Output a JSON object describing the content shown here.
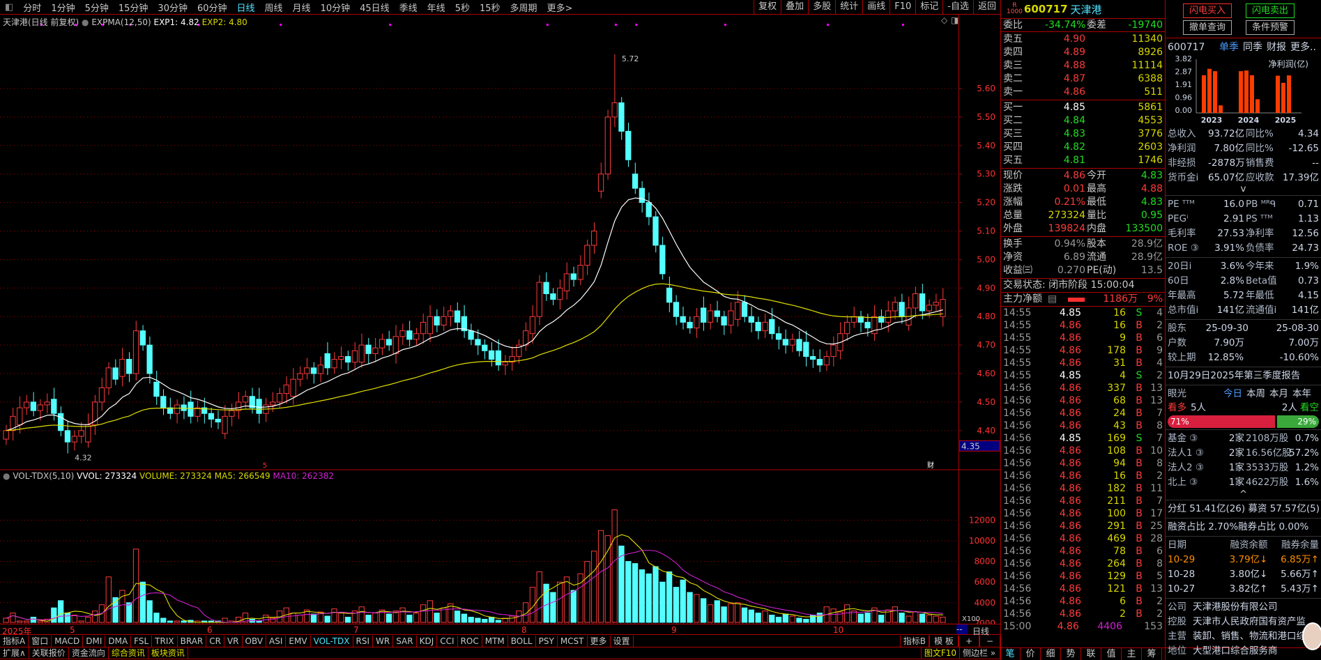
{
  "toolbar": {
    "periods": [
      "分时",
      "1分钟",
      "5分钟",
      "15分钟",
      "30分钟",
      "60分钟",
      "日线",
      "周线",
      "月线",
      "10分钟",
      "45日线",
      "季线",
      "年线",
      "5秒",
      "15秒",
      "多周期",
      "更多>"
    ],
    "active": "日线",
    "right": [
      "复权",
      "叠加",
      "多股",
      "统计",
      "画线",
      "F10",
      "标记",
      "-自选",
      "返回"
    ]
  },
  "chart_header": {
    "title": "天津港(日线 前复权)",
    "indicator": "EXPMA(12,50)",
    "exp1": "EXP1: 4.82",
    "exp2": "EXP2: 4.80"
  },
  "vol_header": {
    "name": "VOL-TDX(5,10)",
    "vvol": "VVOL: 273324",
    "volume": "VOLUME: 273324",
    "ma5": "MA5: 266549",
    "ma10": "MA10: 262382"
  },
  "colors": {
    "up": "#ff3b3b",
    "down": "#54ffff",
    "exp1": "#ffffff",
    "exp2": "#e0e000",
    "ma5": "#e0e000",
    "ma10": "#d020d0",
    "grid": "#b00000"
  },
  "chart_data": {
    "type": "candlestick",
    "price_ticks": [
      "5.60",
      "5.50",
      "5.40",
      "5.30",
      "5.20",
      "5.10",
      "5.00",
      "4.90",
      "4.80",
      "4.70",
      "4.60",
      "4.50",
      "4.40"
    ],
    "current_axis_label": "4.35",
    "high_label": "5.72",
    "high_index": 89,
    "low_label": "4.32",
    "low_index": 9,
    "closes": [
      4.4,
      4.45,
      4.48,
      4.5,
      4.47,
      4.49,
      4.5,
      4.46,
      4.4,
      4.36,
      4.38,
      4.4,
      4.42,
      4.5,
      4.55,
      4.62,
      4.58,
      4.65,
      4.6,
      4.75,
      4.7,
      4.6,
      4.52,
      4.48,
      4.46,
      4.49,
      4.47,
      4.45,
      4.48,
      4.46,
      4.44,
      4.43,
      4.45,
      4.47,
      4.5,
      4.52,
      4.48,
      4.46,
      4.49,
      4.5,
      4.53,
      4.56,
      4.58,
      4.6,
      4.62,
      4.6,
      4.63,
      4.62,
      4.65,
      4.66,
      4.64,
      4.68,
      4.7,
      4.67,
      4.69,
      4.72,
      4.7,
      4.73,
      4.75,
      4.72,
      4.74,
      4.78,
      4.8,
      4.77,
      4.8,
      4.82,
      4.78,
      4.75,
      4.72,
      4.7,
      4.68,
      4.65,
      4.63,
      4.64,
      4.66,
      4.7,
      4.75,
      4.8,
      4.92,
      4.88,
      4.86,
      4.9,
      4.95,
      4.93,
      4.98,
      5.05,
      5.1,
      5.3,
      5.5,
      5.55,
      5.45,
      5.35,
      5.25,
      5.2,
      5.15,
      5.05,
      4.95,
      4.85,
      4.8,
      4.78,
      4.76,
      4.8,
      4.78,
      4.82,
      4.8,
      4.77,
      4.82,
      4.85,
      4.8,
      4.78,
      4.75,
      4.78,
      4.74,
      4.72,
      4.7,
      4.72,
      4.68,
      4.66,
      4.65,
      4.63,
      4.66,
      4.7,
      4.74,
      4.78,
      4.8,
      4.78,
      4.76,
      4.8,
      4.78,
      4.82,
      4.85,
      4.8,
      4.83,
      4.88,
      4.82,
      4.84,
      4.85,
      4.86
    ],
    "volumes": [
      2500,
      3000,
      2200,
      1800,
      2600,
      2000,
      2400,
      3500,
      4200,
      3000,
      2800,
      2200,
      2600,
      3200,
      3800,
      6500,
      4500,
      5200,
      4000,
      9200,
      6000,
      4200,
      3000,
      2500,
      2200,
      1800,
      2000,
      2300,
      1900,
      2100,
      1700,
      2200,
      2500,
      2000,
      2600,
      3000,
      2400,
      2200,
      2800,
      2500,
      3200,
      3500,
      3000,
      2800,
      3300,
      2900,
      3100,
      2700,
      3400,
      3000,
      2600,
      3200,
      3600,
      2800,
      3000,
      3300,
      2900,
      3200,
      3500,
      2800,
      3000,
      3800,
      4200,
      3000,
      3500,
      3900,
      3200,
      2900,
      2600,
      2500,
      2400,
      2600,
      2300,
      2500,
      2700,
      3200,
      4000,
      5500,
      7000,
      5800,
      5000,
      6000,
      6500,
      5200,
      6800,
      8000,
      9000,
      11000,
      10500,
      13000,
      9500,
      8000,
      7800,
      7200,
      6800,
      7500,
      6000,
      7000,
      5500,
      6200,
      5000,
      4800,
      4400,
      3800,
      4200,
      3600,
      3900,
      4000,
      3500,
      3300,
      3000,
      3200,
      2800,
      2600,
      2900,
      2700,
      2500,
      2400,
      2800,
      3000,
      3600,
      3400,
      3100,
      3800,
      3200,
      2900,
      3000,
      3500,
      2800,
      3300,
      3600,
      3000,
      2700,
      3100,
      2900,
      2800,
      2700,
      2600
    ],
    "vol_ticks": [
      "12000",
      "10000",
      "8000",
      "6000",
      "4000",
      "2000"
    ],
    "vol_unit": "X100"
  },
  "dates": {
    "year": "2025年",
    "months": [
      "5",
      "6",
      "7",
      "8",
      "9",
      "10"
    ],
    "period": "日线",
    "blank": "--",
    "marker5": "5",
    "marker_cai": "财"
  },
  "indicators": [
    "指标A",
    "窗口",
    "MACD",
    "DMI",
    "DMA",
    "FSL",
    "TRIX",
    "BRAR",
    "CR",
    "VR",
    "OBV",
    "ASI",
    "EMV",
    "VOL-TDX",
    "RSI",
    "WR",
    "SAR",
    "KDJ",
    "CCI",
    "ROC",
    "MTM",
    "BOLL",
    "PSY",
    "MCST",
    "更多",
    "设置"
  ],
  "indicators_active": "VOL-TDX",
  "indicators_right": [
    "指标B",
    "模 板",
    "+",
    "−"
  ],
  "extra_tabs": [
    "扩展∧",
    "关联报价",
    "资金流向",
    "综合资讯",
    "板块资讯"
  ],
  "extra_right": [
    "图文F10",
    "侧边栏 »"
  ],
  "quote": {
    "badge_top": "R",
    "badge_bottom": "1000",
    "code": "600717",
    "name": "天津港",
    "weibi": {
      "label": "委比",
      "value": "-34.74%",
      "label2": "委差",
      "value2": "-19740"
    },
    "sells": [
      {
        "l": "卖五",
        "p": "4.90",
        "v": "11340"
      },
      {
        "l": "卖四",
        "p": "4.89",
        "v": "8926"
      },
      {
        "l": "卖三",
        "p": "4.88",
        "v": "11114"
      },
      {
        "l": "卖二",
        "p": "4.87",
        "v": "6388"
      },
      {
        "l": "卖一",
        "p": "4.86",
        "v": "511"
      }
    ],
    "buys": [
      {
        "l": "买一",
        "p": "4.85",
        "v": "5861",
        "c": "w"
      },
      {
        "l": "买二",
        "p": "4.84",
        "v": "4553",
        "c": "g"
      },
      {
        "l": "买三",
        "p": "4.83",
        "v": "3776",
        "c": "g"
      },
      {
        "l": "买四",
        "p": "4.82",
        "v": "2603",
        "c": "g"
      },
      {
        "l": "买五",
        "p": "4.81",
        "v": "1746",
        "c": "g"
      }
    ],
    "stats": [
      {
        "l": "现价",
        "v": "4.86",
        "c": "r",
        "l2": "今开",
        "v2": "4.83",
        "c2": "g"
      },
      {
        "l": "涨跌",
        "v": "0.01",
        "c": "r",
        "l2": "最高",
        "v2": "4.88",
        "c2": "r"
      },
      {
        "l": "涨幅",
        "v": "0.21%",
        "c": "r",
        "l2": "最低",
        "v2": "4.83",
        "c2": "g"
      },
      {
        "l": "总量",
        "v": "273324",
        "c": "y",
        "l2": "量比",
        "v2": "0.95",
        "c2": "g"
      },
      {
        "l": "外盘",
        "v": "139824",
        "c": "r",
        "l2": "内盘",
        "v2": "133500",
        "c2": "g"
      }
    ],
    "stats2": [
      {
        "l": "换手",
        "v": "0.94%",
        "l2": "股本",
        "v2": "28.9亿"
      },
      {
        "l": "净资",
        "v": "6.89",
        "l2": "流通",
        "v2": "28.9亿"
      },
      {
        "l": "收益㈢",
        "v": "0.270",
        "l2": "PE(动)",
        "v2": "13.5"
      }
    ],
    "status": "交易状态: 闭市阶段 15:00:04",
    "mainflow": {
      "label": "主力净额",
      "value": "1186万",
      "pct": "9%"
    }
  },
  "ticks": [
    [
      "14:55",
      "4.85",
      "16",
      "S",
      "4"
    ],
    [
      "14:55",
      "4.86",
      "16",
      "B",
      "2"
    ],
    [
      "14:55",
      "4.86",
      "9",
      "B",
      "6"
    ],
    [
      "14:55",
      "4.86",
      "178",
      "B",
      "9"
    ],
    [
      "14:55",
      "4.86",
      "31",
      "B",
      "4"
    ],
    [
      "14:55",
      "4.85",
      "4",
      "S",
      "2"
    ],
    [
      "14:56",
      "4.86",
      "337",
      "B",
      "13"
    ],
    [
      "14:56",
      "4.86",
      "68",
      "B",
      "13"
    ],
    [
      "14:56",
      "4.86",
      "24",
      "B",
      "7"
    ],
    [
      "14:56",
      "4.86",
      "43",
      "B",
      "8"
    ],
    [
      "14:56",
      "4.85",
      "169",
      "S",
      "7"
    ],
    [
      "14:56",
      "4.86",
      "108",
      "B",
      "10"
    ],
    [
      "14:56",
      "4.86",
      "94",
      "B",
      "8"
    ],
    [
      "14:56",
      "4.86",
      "16",
      "B",
      "2"
    ],
    [
      "14:56",
      "4.86",
      "182",
      "B",
      "11"
    ],
    [
      "14:56",
      "4.86",
      "211",
      "B",
      "7"
    ],
    [
      "14:56",
      "4.86",
      "100",
      "B",
      "17"
    ],
    [
      "14:56",
      "4.86",
      "291",
      "B",
      "25"
    ],
    [
      "14:56",
      "4.86",
      "469",
      "B",
      "28"
    ],
    [
      "14:56",
      "4.86",
      "78",
      "B",
      "6"
    ],
    [
      "14:56",
      "4.86",
      "264",
      "B",
      "8"
    ],
    [
      "14:56",
      "4.86",
      "129",
      "B",
      "5"
    ],
    [
      "14:56",
      "4.86",
      "121",
      "B",
      "13"
    ],
    [
      "14:56",
      "4.86",
      "6",
      "B",
      "2"
    ],
    [
      "14:56",
      "4.86",
      "2",
      "B",
      "2"
    ],
    [
      "15:00",
      "4.86",
      "4406",
      "",
      "153"
    ]
  ],
  "mid_tabs": [
    "笔",
    "价",
    "细",
    "势",
    "联",
    "值",
    "主",
    "筹"
  ],
  "right": {
    "buy": "闪电买入",
    "sell": "闪电卖出",
    "cancel": "撤单查询",
    "alert": "条件预警",
    "code": "600717",
    "tabs": [
      "单季",
      "同季",
      "财报",
      "更多.."
    ],
    "profit_chart": {
      "title": "净利润(亿)",
      "yticks": [
        "3.82",
        "2.87",
        "1.91",
        "0.96",
        "0.00"
      ],
      "years": [
        "2023",
        "2024",
        "2025"
      ],
      "values": [
        [
          2.75,
          3.22,
          3.05,
          0.55
        ],
        [
          3.05,
          3.1,
          2.75,
          1.0
        ],
        [
          2.72,
          2.2,
          2.74
        ]
      ],
      "max": 3.82
    },
    "fin": [
      [
        "总收入",
        "93.72亿",
        "同比%",
        "4.34"
      ],
      [
        "净利润",
        "7.80亿",
        "同比%",
        "-12.65"
      ],
      [
        "非经损",
        "-2878万",
        "销售费",
        "--"
      ],
      [
        "货币金i",
        "65.07亿",
        "应收款",
        "17.39亿"
      ]
    ],
    "expand": "v",
    "val": [
      [
        "PE ᵀᵀᴹ",
        "16.0",
        "PB ᴹᴿᑫ",
        "0.71"
      ],
      [
        "PEGⁱ",
        "2.91",
        "PS ᵀᵀᴹ",
        "1.13"
      ],
      [
        "毛利率",
        "27.53",
        "净利率",
        "12.56"
      ],
      [
        "ROE ③",
        "3.91%",
        "负债率",
        "24.73"
      ]
    ],
    "perf": [
      [
        "20日i",
        "3.6%",
        "今年来",
        "1.9%"
      ],
      [
        "60日",
        "2.8%",
        "Beta值",
        "0.73"
      ],
      [
        "年最高",
        "5.72",
        "年最低",
        "4.15"
      ],
      [
        "总市值i",
        "141亿",
        "流通值i",
        "141亿"
      ]
    ],
    "holders": [
      [
        "股东",
        "25-09-30",
        "",
        "25-08-30"
      ],
      [
        "户数",
        "7.90万",
        "",
        "7.00万"
      ],
      [
        "较上期",
        "12.85%",
        "",
        "-10.60%"
      ]
    ],
    "report": "10月29日2025年第三季度报告",
    "vision": {
      "label": "眼光",
      "tabs": [
        "今日",
        "本周",
        "本月",
        "本年"
      ],
      "bull": "看多",
      "bull_n": "5人",
      "bear_n": "2人",
      "bear": "看空",
      "bull_pct": "71%",
      "bear_pct": "29%",
      "bull_frac": 0.71
    },
    "inst": [
      [
        "基金 ③",
        "2家",
        "2108万股",
        "0.7%"
      ],
      [
        "法人1 ③",
        "2家",
        "16.56亿股",
        "57.2%"
      ],
      [
        "法人2 ③",
        "1家",
        "3533万股",
        "1.2%"
      ],
      [
        "北上 ③",
        "1家",
        "4622万股",
        "1.6%"
      ]
    ],
    "collapse": "^",
    "dividend": "分红  51.41亿(26) 募资  57.57亿(5)",
    "margin": "融资占比  2.70%融券占比   0.00%",
    "margin_hdr": [
      "日期",
      "融资余额",
      "融券余量"
    ],
    "margin_rows": [
      [
        "10-29",
        "3.79亿↓",
        "6.85万↑"
      ],
      [
        "10-28",
        "3.80亿↓",
        "5.66万↑"
      ],
      [
        "10-27",
        "3.82亿↑",
        "5.43万↑"
      ]
    ],
    "profile": [
      [
        "公司",
        "天津港股份有限公司"
      ],
      [
        "控股",
        "天津市人民政府国有资产监"
      ],
      [
        "主营",
        "装卸、销售、物流和港口综"
      ],
      [
        "地位",
        "大型港口综合服务商"
      ]
    ]
  }
}
